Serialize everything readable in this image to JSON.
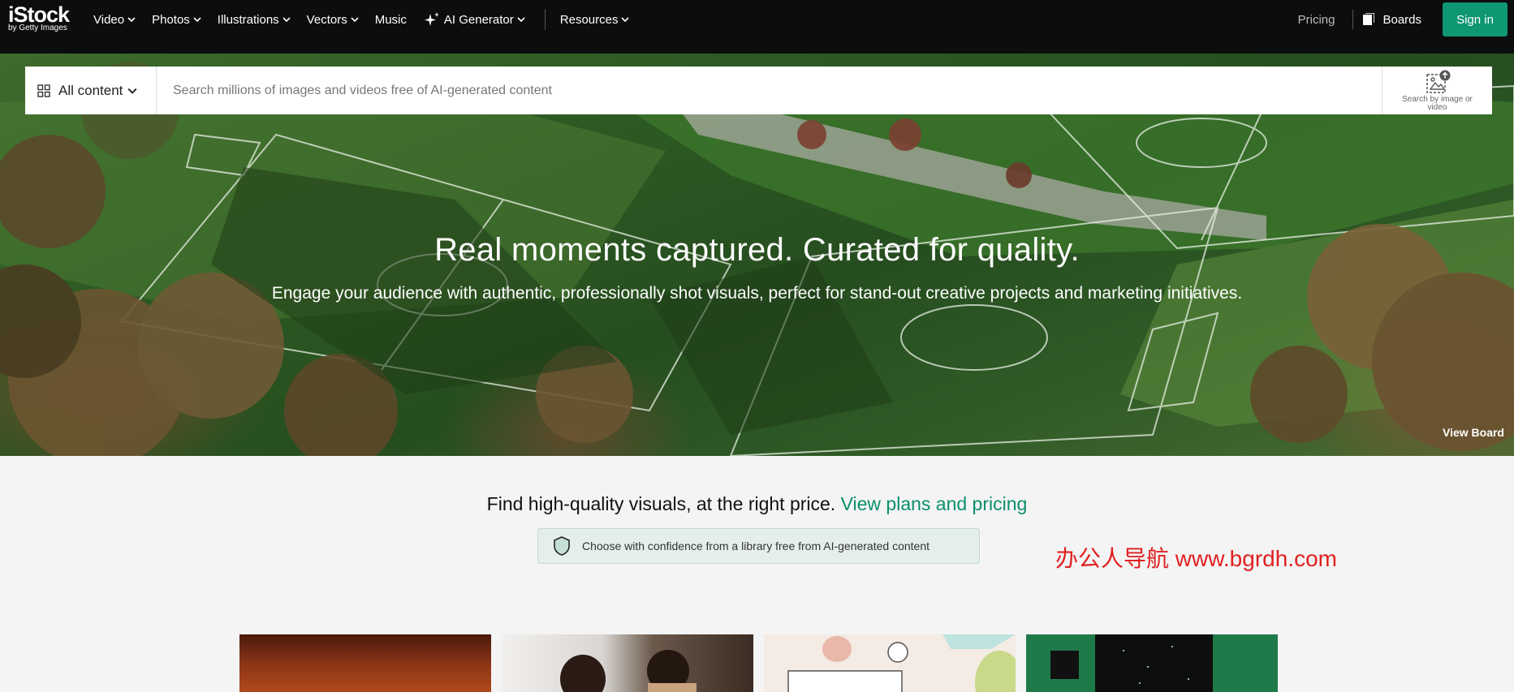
{
  "nav": {
    "logo_main": "iStock",
    "logo_sub": "by Getty Images",
    "items": [
      {
        "label": "Video"
      },
      {
        "label": "Photos"
      },
      {
        "label": "Illustrations"
      },
      {
        "label": "Vectors"
      },
      {
        "label": "Music"
      },
      {
        "label": "AI Generator"
      }
    ],
    "resources": "Resources",
    "pricing": "Pricing",
    "boards": "Boards",
    "signin": "Sign in"
  },
  "search": {
    "content_type": "All content",
    "placeholder": "Search millions of images and videos free of AI-generated content",
    "image_search_label": "Search by image or video"
  },
  "hero": {
    "title": "Real moments captured. Curated for quality.",
    "subtitle": "Engage your audience with authentic, professionally shot visuals, perfect for stand-out creative projects and marketing initiatives.",
    "view_board": "View Board"
  },
  "main": {
    "tagline": "Find high-quality visuals, at the right price.",
    "tagline_link": "View plans and pricing",
    "confidence": "Choose with confidence from a library free from AI-generated content"
  },
  "watermark": "办公人导航  www.bgrdh.com",
  "colors": {
    "nav_bg": "#0c0d0d",
    "accent": "#0f9672",
    "link": "#0c8f6c"
  }
}
